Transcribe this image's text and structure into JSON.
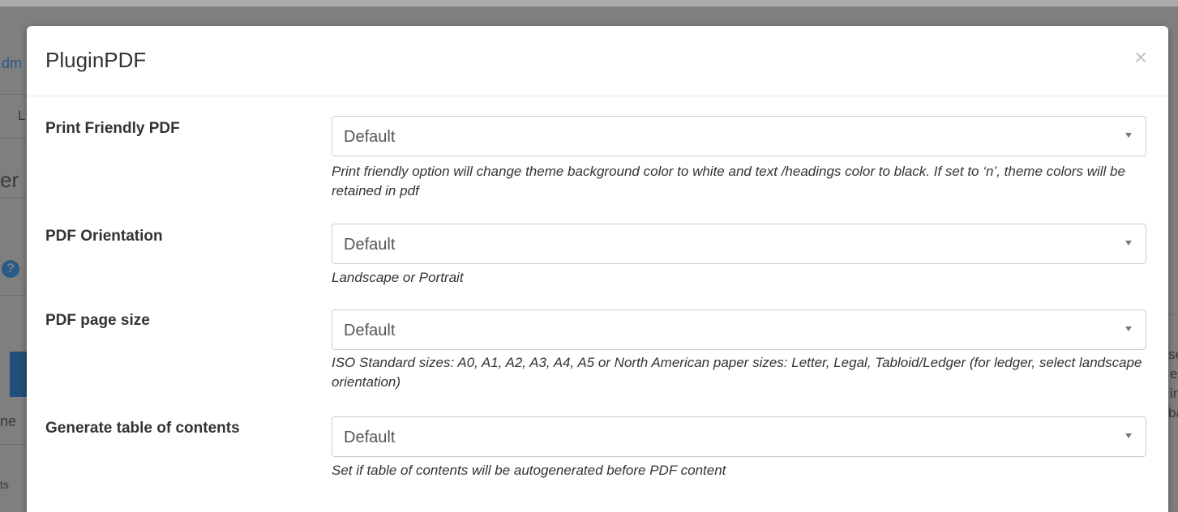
{
  "modal": {
    "title": "PluginPDF",
    "close_glyph": "×"
  },
  "background_peek": {
    "left_fragments": [
      "dm",
      "L",
      "er",
      "ne",
      "ts"
    ],
    "right_fragments": [
      "se",
      "e",
      "in",
      "ba"
    ],
    "colors": {
      "overlay": "#7f7f7f",
      "link": "#2a5a86",
      "button": "#1f4f78"
    }
  },
  "fields": [
    {
      "label": "Print Friendly PDF",
      "value": "Default",
      "help": "Print friendly option will change theme background color to white and text /headings color to black. If set to ‘n’, theme colors will be retained in pdf"
    },
    {
      "label": "PDF Orientation",
      "value": "Default",
      "help": "Landscape or Portrait"
    },
    {
      "label": "PDF page size",
      "value": "Default",
      "help": "ISO Standard sizes: A0, A1, A2, A3, A4, A5 or North American paper sizes: Letter, Legal, Tabloid/Ledger (for ledger, select landscape orientation)"
    },
    {
      "label": "Generate table of contents",
      "value": "Default",
      "help": "Set if table of contents will be autogenerated before PDF content"
    }
  ]
}
